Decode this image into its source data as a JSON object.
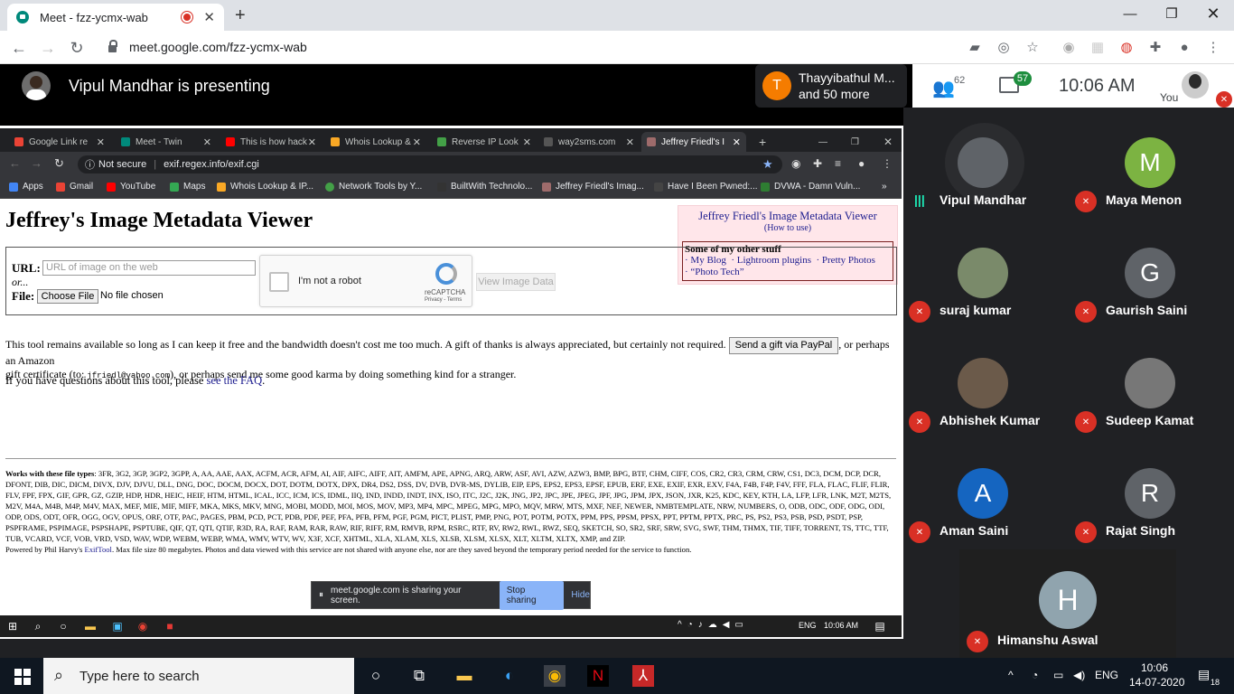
{
  "outer_tab": {
    "title": "Meet - fzz-ycmx-wab",
    "close": "✕"
  },
  "outer_url": "meet.google.com/fzz-ycmx-wab",
  "meet": {
    "presenting": "Vipul Mandhar is presenting",
    "top_participant": {
      "initial": "T",
      "line1": "Thayyibathul M...",
      "line2": "and 50 more"
    },
    "people_count": "62",
    "chat_count": "57",
    "time": "10:06 AM",
    "you_label": "You",
    "participants": [
      {
        "name": "Vipul Mandhar",
        "initial": "",
        "color": "#5f6368"
      },
      {
        "name": "Maya Menon",
        "initial": "M",
        "color": "#7cb342"
      },
      {
        "name": "suraj kumar",
        "initial": "",
        "color": "#7a8a6a"
      },
      {
        "name": "Gaurish Saini",
        "initial": "G",
        "color": "#5f6368"
      },
      {
        "name": "Abhishek Kumar",
        "initial": "",
        "color": "#6b5a4a"
      },
      {
        "name": "Sudeep Kamat",
        "initial": "",
        "color": "#777"
      },
      {
        "name": "Aman Saini",
        "initial": "A",
        "color": "#1565c0"
      },
      {
        "name": "Rajat Singh",
        "initial": "R",
        "color": "#5f6368"
      },
      {
        "name": "Himanshu Aswal",
        "initial": "H",
        "color": "#90a4ae"
      }
    ]
  },
  "inner": {
    "tabs": [
      {
        "label": "Google Link re",
        "color": "#ea4335"
      },
      {
        "label": "Meet - Twin",
        "color": "#00897b"
      },
      {
        "label": "This is how hack",
        "color": "#ff0000"
      },
      {
        "label": "Whois Lookup &",
        "color": "#f9a825"
      },
      {
        "label": "Reverse IP Look",
        "color": "#43a047"
      },
      {
        "label": "way2sms.com",
        "color": "#555"
      },
      {
        "label": "Jeffrey Friedl's I",
        "color": "#9e6b6b"
      }
    ],
    "security": "Not secure",
    "url": "exif.regex.info/exif.cgi",
    "bookmarks": [
      "Apps",
      "Gmail",
      "YouTube",
      "Maps",
      "Whois Lookup & IP...",
      "Network Tools by Y...",
      "BuiltWith Technolo...",
      "Jeffrey Friedl's Imag...",
      "Have I Been Pwned:...",
      "DVWA - Damn Vuln..."
    ],
    "page": {
      "title": "Jeffrey's Image Metadata Viewer",
      "sidebox_title": "Jeffrey Friedl's Image Metadata Viewer",
      "how_to": "How to use",
      "other_stuff": "Some of my other stuff",
      "links": [
        "My Blog",
        "Lightroom plugins",
        "Pretty Photos",
        "“Photo Tech”"
      ],
      "url_label": "URL:",
      "url_placeholder": "URL of image on the web",
      "or": "or...",
      "file_label": "File:",
      "choose_file": "Choose File",
      "no_file": "No file chosen",
      "captcha_text": "I'm not a robot",
      "captcha_brand": "reCAPTCHA",
      "captcha_terms": "Privacy - Terms",
      "view_button": "View Image Data",
      "para1a": "This tool remains available so long as I can keep it free and the bandwidth doesn't cost me too much. A gift of thanks is always appreciated, but certainly not required.",
      "paypal": "Send a gift via PayPal",
      "para1b": ", or perhaps an Amazon",
      "para1c": "gift certificate (to:",
      "email": "jfriedl@yahoo.com",
      "para1d": "), or perhaps send me some good karma by doing something kind for a stranger.",
      "faq_pre": "If you have questions about this tool, please",
      "faq_link": "see the FAQ",
      "types_label": "Works with these file types",
      "types": ": 3FR, 3G2, 3GP, 3GP2, 3GPP, A, AA, AAE, AAX, ACFM, ACR, AFM, AI, AIF, AIFC, AIFF, AIT, AMFM, APE, APNG, ARQ, ARW, ASF, AVI, AZW, AZW3, BMP, BPG, BTF, CHM, CIFF, COS, CR2, CR3, CRM, CRW, CS1, DC3, DCM, DCP, DCR, DFONT, DIB, DIC, DICM, DIVX, DJV, DJVU, DLL, DNG, DOC, DOCM, DOCX, DOT, DOTM, DOTX, DPX, DR4, DS2, DSS, DV, DVB, DVR-MS, DYLIB, EIP, EPS, EPS2, EPS3, EPSF, EPUB, ERF, EXE, EXIF, EXR, EXV, F4A, F4B, F4P, F4V, FFF, FLA, FLAC, FLIF, FLIR, FLV, FPF, FPX, GIF, GPR, GZ, GZIP, HDP, HDR, HEIC, HEIF, HTM, HTML, ICAL, ICC, ICM, ICS, IDML, IIQ, IND, INDD, INDT, INX, ISO, ITC, J2C, J2K, JNG, JP2, JPC, JPE, JPEG, JPF, JPG, JPM, JPX, JSON, JXR, K25, KDC, KEY, KTH, LA, LFP, LFR, LNK, M2T, M2TS, M2V, M4A, M4B, M4P, M4V, MAX, MEF, MIE, MIF, MIFF, MKA, MKS, MKV, MNG, MOBI, MODD, MOI, MOS, MOV, MP3, MP4, MPC, MPEG, MPG, MPO, MQV, MRW, MTS, MXF, NEF, NEWER, NMBTEMPLATE, NRW, NUMBERS, O, ODB, ODC, ODF, ODG, ODI, ODP, ODS, ODT, OFR, OGG, OGV, OPUS, ORF, OTF, PAC, PAGES, PBM, PCD, PCT, PDB, PDF, PEF, PFA, PFB, PFM, PGF, PGM, PICT, PLIST, PMP, PNG, POT, POTM, POTX, PPM, PPS, PPSM, PPSX, PPT, PPTM, PPTX, PRC, PS, PS2, PS3, PSB, PSD, PSDT, PSP, PSPFRAME, PSPIMAGE, PSPSHAPE, PSPTUBE, QIF, QT, QTI, QTIF, R3D, RA, RAF, RAM, RAR, RAW, RIF, RIFF, RM, RMVB, RPM, RSRC, RTF, RV, RW2, RWL, RWZ, SEQ, SKETCH, SO, SR2, SRF, SRW, SVG, SWF, THM, THMX, TIF, TIFF, TORRENT, TS, TTC, TTF, TUB, VCARD, VCF, VOB, VRD, VSD, WAV, WDP, WEBM, WEBP, WMA, WMV, WTV, WV, X3F, XCF, XHTML, XLA, XLAM, XLS, XLSB, XLSM, XLSX, XLT, XLTM, XLTX, XMP, and ZIP.",
      "powered_pre": "Powered by Phil Harvy's",
      "exiftool": "ExifTool",
      "powered_post": ". Max file size 80 megabytes. Photos and data viewed with this service are not shared with anyone else, nor are they saved beyond the temporary period needed for the service to function."
    },
    "share_notice": "meet.google.com is sharing your screen.",
    "stop_sharing": "Stop sharing",
    "hide": "Hide",
    "tray_lang": "ENG",
    "tray_time": "10:06 AM"
  },
  "taskbar": {
    "search_placeholder": "Type here to search",
    "lang": "ENG",
    "time": "10:06",
    "date": "14-07-2020",
    "notif_count": "18"
  }
}
